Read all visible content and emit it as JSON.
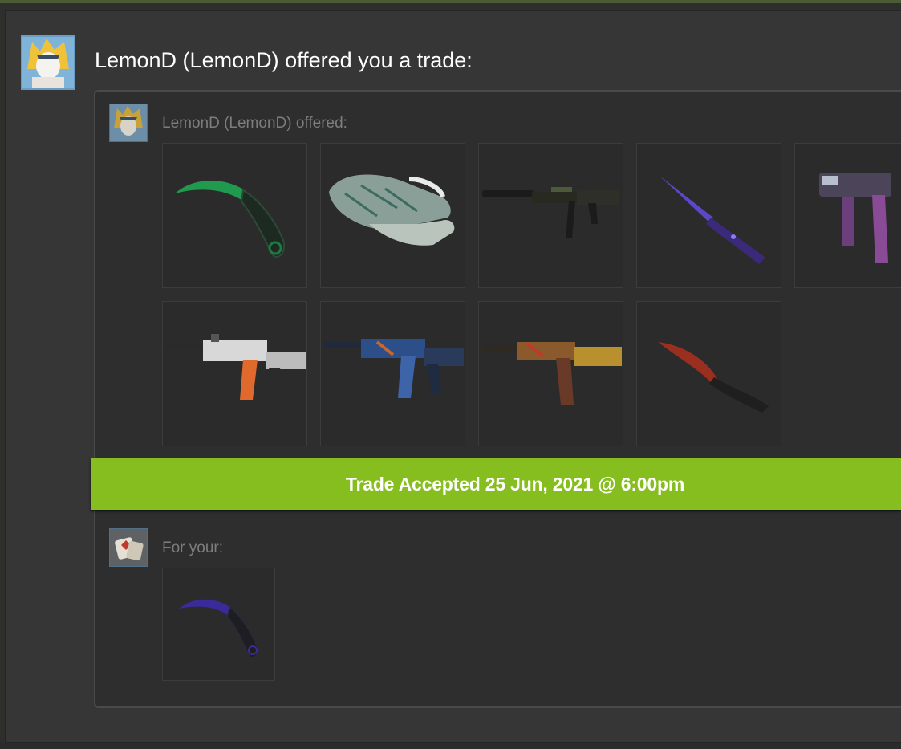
{
  "header": {
    "title": "LemonD (LemonD) offered you a trade:"
  },
  "offer": {
    "label": "LemonD (LemonD) offered:",
    "items": [
      {
        "icon": "karambit-knife-icon"
      },
      {
        "icon": "gloves-icon"
      },
      {
        "icon": "m4a1-s-rifle-icon"
      },
      {
        "icon": "stiletto-knife-icon"
      },
      {
        "icon": "mp9-smg-icon"
      },
      {
        "icon": "m4a4-rifle-icon"
      },
      {
        "icon": "m4a4-rifle-icon"
      },
      {
        "icon": "ak47-rifle-icon"
      },
      {
        "icon": "bowie-knife-icon"
      }
    ]
  },
  "banner": {
    "text": "Trade Accepted 25 Jun, 2021 @ 6:00pm",
    "color": "#86bd1f"
  },
  "request": {
    "label": "For your:",
    "items": [
      {
        "icon": "karambit-knife-icon"
      }
    ]
  }
}
